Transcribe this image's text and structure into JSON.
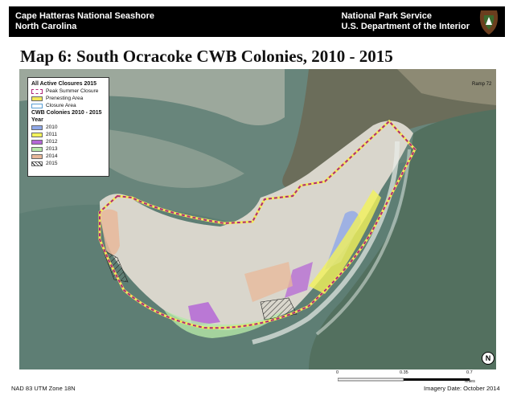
{
  "header": {
    "left_line1": "Cape Hatteras National Seashore",
    "left_line2": "North Carolina",
    "right_line1": "National Park Service",
    "right_line2": "U.S. Department of the Interior"
  },
  "title": "Map 6:  South Ocracoke CWB Colonies, 2010 - 2015",
  "legend": {
    "closures_heading": "All Active Closures 2015",
    "closures": [
      {
        "label": "Peak Summer Closure",
        "style": "dashed",
        "color": "#b0287a"
      },
      {
        "label": "Prenesting Area",
        "color": "#f2e85a"
      },
      {
        "label": "Closure Area",
        "color": "#5a9fd4"
      }
    ],
    "colonies_heading": "CWB Colonies 2010 - 2015",
    "year_heading": "Year",
    "years": [
      {
        "label": "2010",
        "color": "#8fa8e8"
      },
      {
        "label": "2011",
        "color": "#f2f25a"
      },
      {
        "label": "2012",
        "color": "#b467d6"
      },
      {
        "label": "2013",
        "color": "#b5e8a8"
      },
      {
        "label": "2014",
        "color": "#e8b89a"
      },
      {
        "label": "2015",
        "color": "hatched"
      }
    ]
  },
  "ramp_label": "Ramp 72",
  "compass_icon": "north-arrow",
  "scale": {
    "ticks": [
      "0",
      "0.35",
      "0.7"
    ],
    "unit": "Miles"
  },
  "footer": {
    "projection": "NAD 83 UTM Zone 18N",
    "imagery": "Imagery Date:  October 2014"
  }
}
